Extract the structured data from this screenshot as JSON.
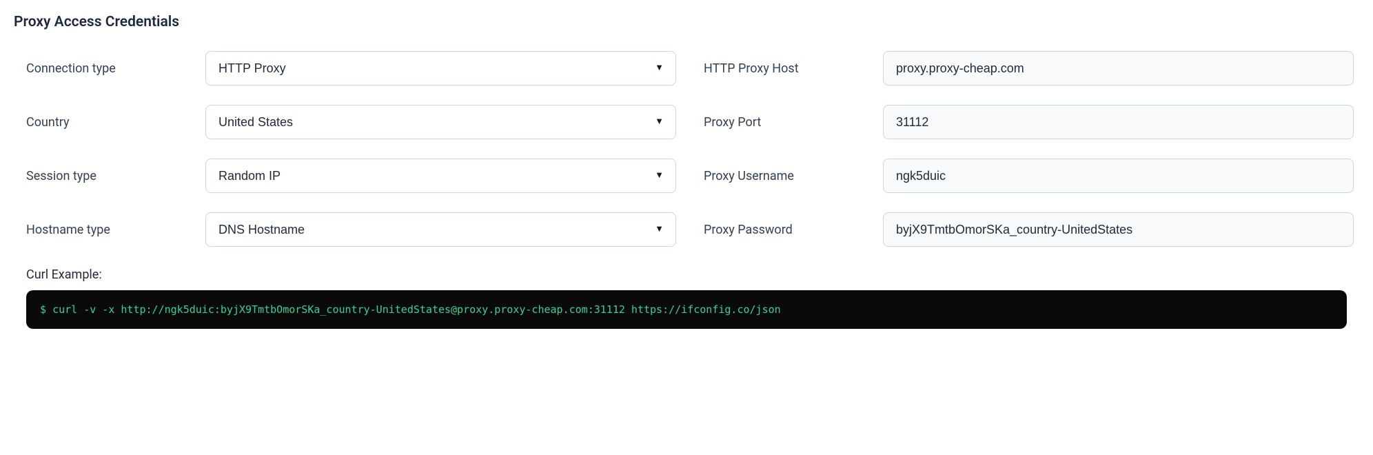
{
  "heading": "Proxy Access Credentials",
  "left": {
    "connection_type": {
      "label": "Connection type",
      "value": "HTTP Proxy"
    },
    "country": {
      "label": "Country",
      "value": "United States"
    },
    "session_type": {
      "label": "Session type",
      "value": "Random IP"
    },
    "hostname_type": {
      "label": "Hostname type",
      "value": "DNS Hostname"
    }
  },
  "right": {
    "host": {
      "label": "HTTP Proxy Host",
      "value": "proxy.proxy-cheap.com"
    },
    "port": {
      "label": "Proxy Port",
      "value": "31112"
    },
    "username": {
      "label": "Proxy Username",
      "value": "ngk5duic"
    },
    "password": {
      "label": "Proxy Password",
      "value": "byjX9TmtbOmorSKa_country-UnitedStates"
    }
  },
  "curl": {
    "label": "Curl Example:",
    "prompt": "$",
    "command": "curl -v -x http://ngk5duic:byjX9TmtbOmorSKa_country-UnitedStates@proxy.proxy-cheap.com:31112 https://ifconfig.co/json"
  }
}
